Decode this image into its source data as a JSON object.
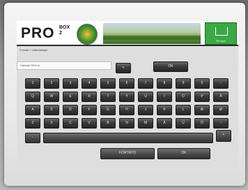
{
  "header": {
    "logo_text": "PRO",
    "logo_small": "BOX 2",
    "cart_label": "Se kurv"
  },
  "breadcrumb": "Forside > Udbetalinger",
  "input": {
    "value": "Udbetal 2500 kr"
  },
  "actions": {
    "backspace": "<",
    "ok_top": "OK",
    "cancel": "FORTRYD",
    "ok": "OK"
  },
  "keyboard": {
    "row1": [
      "1",
      "2",
      "3",
      "4",
      "5",
      "6",
      "7",
      "8",
      "9",
      "0",
      "-"
    ],
    "row2": [
      "Q",
      "W",
      "E",
      "R",
      "T",
      "Y",
      "U",
      "I",
      "O",
      "P",
      "Å"
    ],
    "row3": [
      "A",
      "S",
      "D",
      "F",
      "G",
      "H",
      "J",
      "K",
      "L",
      "Æ",
      "Ø"
    ],
    "row4": [
      "Z",
      "X",
      "C",
      "V",
      "B",
      "N",
      "M",
      "Å",
      "Ü",
      "Ö",
      "-"
    ],
    "row5_left": "-",
    "row5_right": "+"
  }
}
